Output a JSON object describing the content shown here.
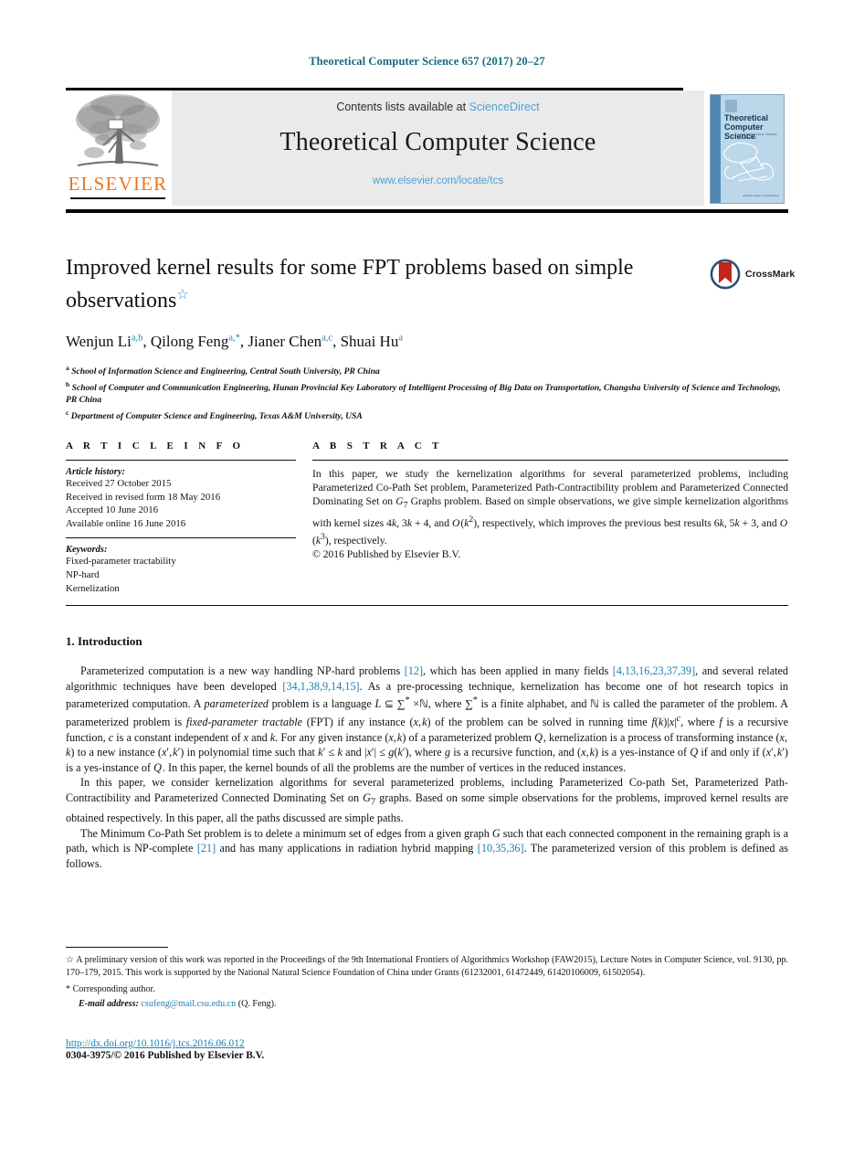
{
  "running_head": "Theoretical Computer Science 657 (2017) 20–27",
  "masthead": {
    "contents_prefix": "Contents lists available at ",
    "sciencedirect_label": "ScienceDirect",
    "journal_title": "Theoretical Computer Science",
    "journal_url": "www.elsevier.com/locate/tcs",
    "publisher_wordmark": "ELSEVIER",
    "cover": {
      "title_line1": "Theoretical",
      "title_line2": "Computer Science",
      "subtitle": "AN INTERNATIONAL JOURNAL OF THE EATCS",
      "footer": "Available online at\nScienceDirect"
    }
  },
  "crossmark": {
    "label": "CrossMark"
  },
  "article": {
    "title": "Improved kernel results for some FPT problems based on simple observations",
    "title_footnote_marker": "☆",
    "authors": [
      {
        "name": "Wenjun Li",
        "sups": "a,b"
      },
      {
        "name": "Qilong Feng",
        "sups": "a,*"
      },
      {
        "name": "Jianer Chen",
        "sups": "a,c"
      },
      {
        "name": "Shuai Hu",
        "sups": "a"
      }
    ],
    "affiliations": [
      {
        "mark": "a",
        "text": "School of Information Science and Engineering, Central South University, PR China"
      },
      {
        "mark": "b",
        "text": "School of Computer and Communication Engineering, Hunan Provincial Key Laboratory of Intelligent Processing of Big Data on Transportation, Changsha University of Science and Technology, PR China"
      },
      {
        "mark": "c",
        "text": "Department of Computer Science and Engineering, Texas A&M University, USA"
      }
    ]
  },
  "article_info": {
    "heading": "A R T I C L E   I N F O",
    "history_label": "Article history:",
    "history": [
      "Received 27 October 2015",
      "Received in revised form 18 May 2016",
      "Accepted 10 June 2016",
      "Available online 16 June 2016"
    ],
    "keywords_label": "Keywords:",
    "keywords": [
      "Fixed-parameter tractability",
      "NP-hard",
      "Kernelization"
    ]
  },
  "abstract": {
    "heading": "A B S T R A C T",
    "copyright": "© 2016 Published by Elsevier B.V."
  },
  "sections": {
    "intro_heading": "1. Introduction"
  },
  "footnotes": {
    "star_marker": "☆",
    "corresponding_marker": "*",
    "corresponding_text": "Corresponding author.",
    "email_label": "E-mail address:",
    "email": "csufeng@mail.csu.edu.cn",
    "email_owner": "(Q. Feng)."
  },
  "bottom": {
    "doi": "http://dx.doi.org/10.1016/j.tcs.2016.06.012",
    "issn_line": "0304-3975/© 2016 Published by Elsevier B.V."
  },
  "colors": {
    "header_teal": "#17697f",
    "link_blue": "#1a7fb5",
    "sciencedirect_blue": "#4ea0d6",
    "elsevier_orange": "#E87722",
    "banner_gray": "#eaeaea"
  }
}
